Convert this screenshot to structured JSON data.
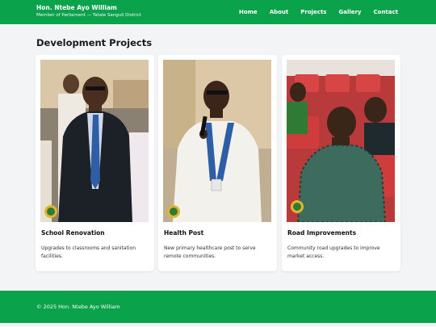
{
  "header": {
    "name": "Hon. Ntebe Ayo William",
    "subtitle": "Member of Parliament — Tatale Sanguli District",
    "nav": [
      "Home",
      "About",
      "Projects",
      "Gallery",
      "Contact"
    ],
    "color": "#0aa24a"
  },
  "section": {
    "title": "Development Projects"
  },
  "cards": [
    {
      "title": "School Renovation",
      "description": "Upgrades to classrooms and sanitation facilities.",
      "image": "man-in-suit-photo"
    },
    {
      "title": "Health Post",
      "description": "New primary healthcare post to serve remote communities.",
      "image": "man-speaking-microphone-photo"
    },
    {
      "title": "Road Improvements",
      "description": "Community road upgrades to improve market access.",
      "image": "man-seated-red-chairs-photo"
    }
  ],
  "footer": {
    "text": "© 2025 Hon. Ntebe Ayo William"
  }
}
